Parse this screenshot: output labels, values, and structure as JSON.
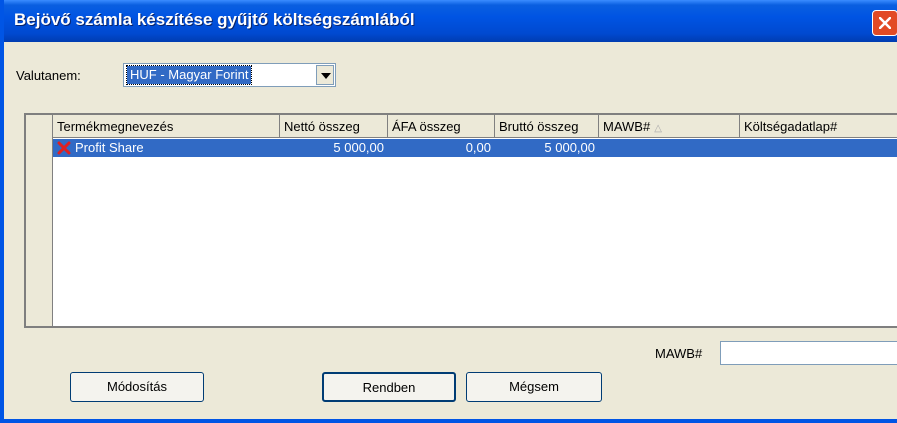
{
  "window": {
    "title": "Bejövő számla készítése gyűjtő költségszámlából"
  },
  "currency": {
    "label": "Valutanem:",
    "selected": "HUF - Magyar Forint"
  },
  "grid": {
    "columns": [
      "Termékmegnevezés",
      "Nettó összeg",
      "ÁFA összeg",
      "Bruttó összeg",
      "MAWB#",
      "Költségadatlap#"
    ],
    "sorted_column": "MAWB#",
    "rows": [
      {
        "name": "Profit Share",
        "net": "5 000,00",
        "vat": "0,00",
        "gross": "5 000,00",
        "mawb": "",
        "cost_sheet": ""
      }
    ]
  },
  "mawb_field": {
    "label": "MAWB#",
    "value": ""
  },
  "buttons": {
    "modify": "Módosítás",
    "ok": "Rendben",
    "cancel": "Mégsem"
  }
}
